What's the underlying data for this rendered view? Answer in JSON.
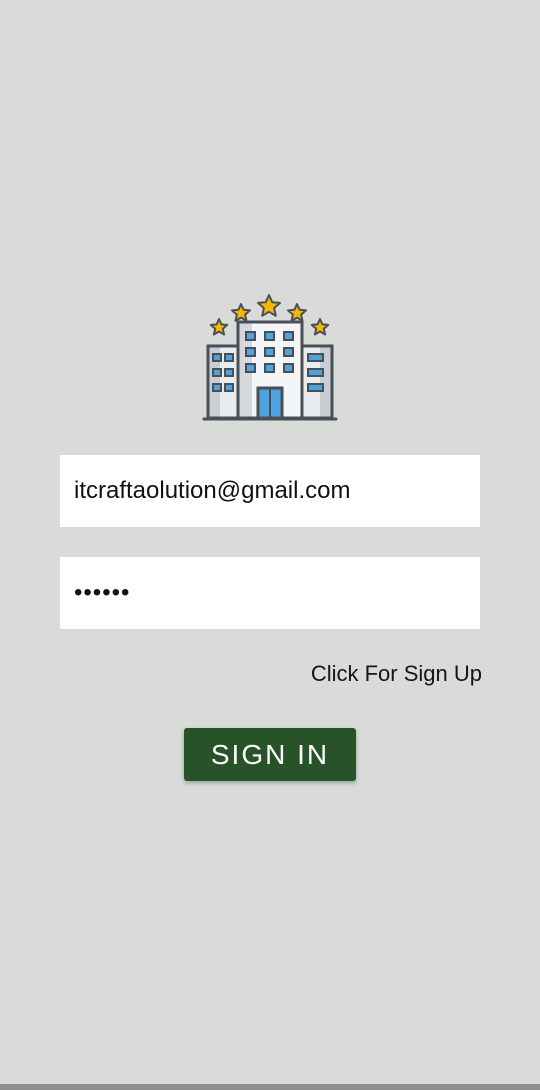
{
  "logo": {
    "icon": "hotel-building-icon",
    "star_color": "#f5b800",
    "window_color": "#4da3df"
  },
  "login": {
    "email_value": "itcraftaolution@gmail.com",
    "password_value": "••••••",
    "signup_link": "Click For Sign Up",
    "signin_label": "SIGN IN"
  },
  "colors": {
    "background": "#d9dbd9",
    "button": "#285328",
    "field": "#ffffff"
  }
}
